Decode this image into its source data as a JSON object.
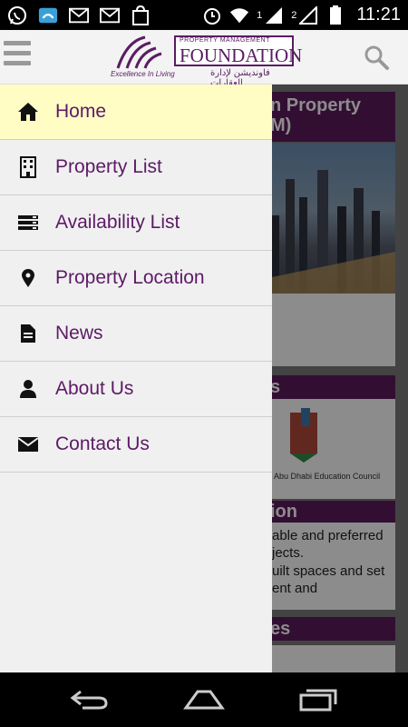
{
  "status_bar": {
    "time": "11:21",
    "sim_label": "1",
    "sim2_label": "2",
    "left_icons": [
      "whatsapp-icon",
      "phone-icon",
      "gmail-icon",
      "gmail-icon",
      "store-icon"
    ]
  },
  "header": {
    "logo": {
      "tagline": "Excellence In Living",
      "small_text": "PROPERTY MANAGEMENT",
      "big_text": "FOUNDATION",
      "arabic_text": "فاونديشن لإدارة العقارات"
    }
  },
  "background": {
    "card1_title": "n Property",
    "card1_title2": "M)",
    "card2_title": "s",
    "partner_text": "Abu Dhabi Education Council",
    "card3_title": "ion",
    "body_lines": [
      "able and preferred",
      "jects.",
      "uilt spaces and set",
      "ent and"
    ],
    "card4_title": "es"
  },
  "drawer": {
    "items": [
      {
        "label": "Home",
        "icon": "home-icon",
        "active": true
      },
      {
        "label": "Property List",
        "icon": "building-icon",
        "active": false
      },
      {
        "label": "Availability List",
        "icon": "list-icon",
        "active": false
      },
      {
        "label": "Property Location",
        "icon": "location-pin-icon",
        "active": false
      },
      {
        "label": "News",
        "icon": "document-icon",
        "active": false
      },
      {
        "label": "About Us",
        "icon": "person-icon",
        "active": false
      },
      {
        "label": "Contact Us",
        "icon": "envelope-icon",
        "active": false
      }
    ]
  },
  "colors": {
    "brand": "#5d1a66",
    "active_item_bg": "#fffdc4",
    "drawer_bg": "#f0f0f0"
  }
}
